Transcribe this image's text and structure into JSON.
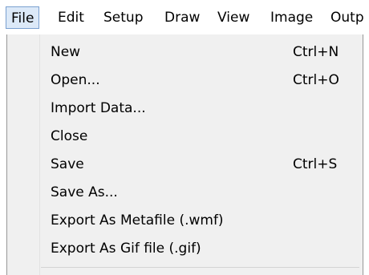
{
  "menubar": {
    "items": [
      {
        "label": "File"
      },
      {
        "label": "Edit"
      },
      {
        "label": "Setup"
      },
      {
        "label": "Draw"
      },
      {
        "label": "View"
      },
      {
        "label": "Image"
      },
      {
        "label": "Outp"
      }
    ]
  },
  "file_menu": {
    "items": [
      {
        "label": "New",
        "shortcut": "Ctrl+N"
      },
      {
        "label": "Open...",
        "shortcut": "Ctrl+O"
      },
      {
        "label": "Import Data..."
      },
      {
        "label": "Close"
      },
      {
        "label": "Save",
        "shortcut": "Ctrl+S"
      },
      {
        "label": "Save As..."
      },
      {
        "label": "Export As Metafile (.wmf)"
      },
      {
        "label": "Export As Gif file (.gif)"
      }
    ]
  }
}
